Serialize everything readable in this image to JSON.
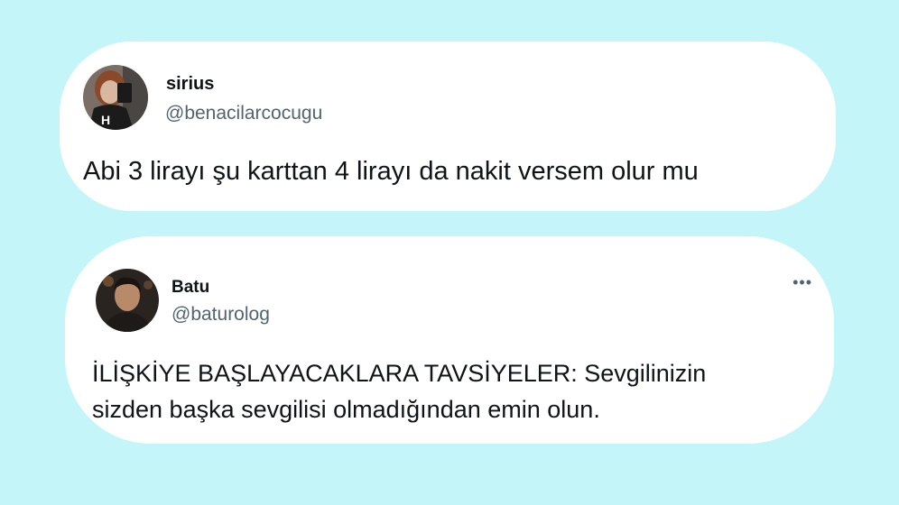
{
  "tweets": [
    {
      "display_name": "sirius",
      "handle": "@benacilarcocugu",
      "text_lines": [
        "Abi 3 lirayı şu karttan 4 lirayı da nakit versem olur mu"
      ]
    },
    {
      "display_name": "Batu",
      "handle": "@baturolog",
      "more_icon": "•••",
      "text_lines": [
        "İLİŞKİYE BAŞLAYACAKLARA TAVSİYELER: Sevgilinizin",
        "sizden başka sevgilisi olmadığından emin olun."
      ]
    }
  ],
  "colors": {
    "background": "#c4f6f9",
    "card": "#ffffff",
    "name": "#0f1419",
    "handle": "#536471",
    "text": "#0f1419"
  }
}
